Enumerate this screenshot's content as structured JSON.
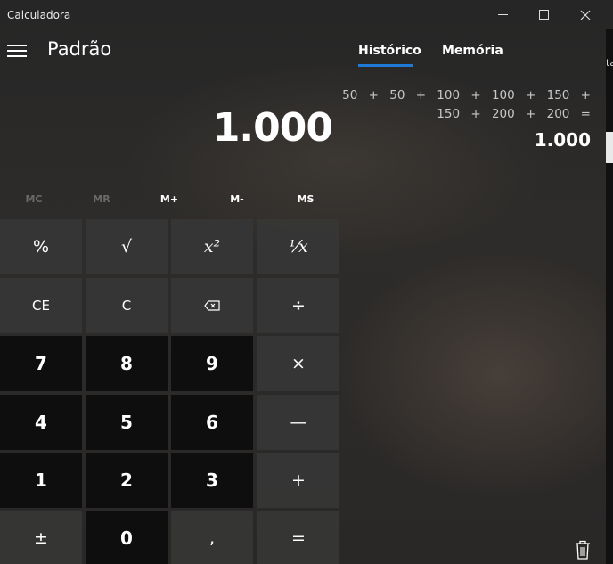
{
  "app": {
    "title": "Calculadora"
  },
  "window": {
    "minimize_glyph": "—",
    "maximize_glyph": "☐",
    "close_glyph": "✕"
  },
  "header": {
    "mode": "Padrão"
  },
  "tabs": [
    {
      "label": "Histórico",
      "active": true
    },
    {
      "label": "Memória",
      "active": false
    }
  ],
  "display": {
    "value": "1.000"
  },
  "history": {
    "line1": "50 + 50 + 100 + 100 + 150 +",
    "line2": "150 + 200 + 200 =",
    "result": "1.000"
  },
  "memory": {
    "mc": "MC",
    "mr": "MR",
    "mplus": "M+",
    "mminus": "M-",
    "ms": "MS"
  },
  "keys": {
    "percent": "%",
    "sqrt": "√",
    "square": "x²",
    "reciprocal": "¹⁄x",
    "ce": "CE",
    "c": "C",
    "backspace": "⌫",
    "divide": "÷",
    "seven": "7",
    "eight": "8",
    "nine": "9",
    "multiply": "×",
    "four": "4",
    "five": "5",
    "six": "6",
    "minus": "—",
    "one": "1",
    "two": "2",
    "three": "3",
    "plus": "+",
    "negate": "±",
    "zero": "0",
    "comma": ",",
    "equals": "="
  },
  "edge": {
    "text": "ta"
  },
  "colors": {
    "accent": "#1f7ad6",
    "num_key": "#0c0c0c",
    "op_key": "#373737"
  }
}
